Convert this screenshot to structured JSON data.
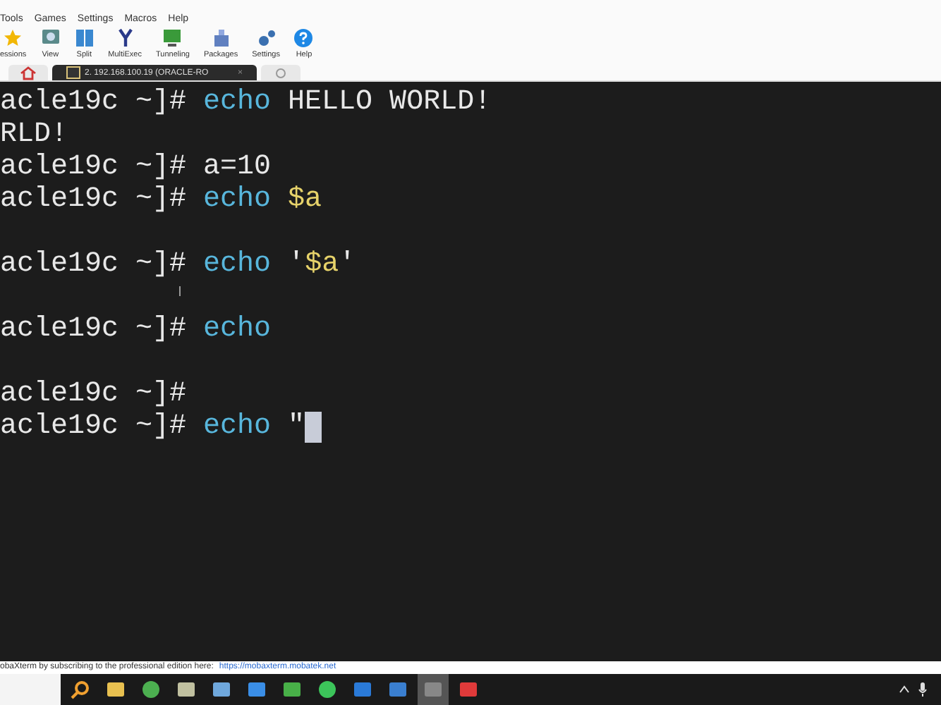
{
  "menu_bar": [
    "Tools",
    "Games",
    "Settings",
    "Macros",
    "Help"
  ],
  "toolbar": [
    {
      "label": "essions",
      "kind": "star"
    },
    {
      "label": "View",
      "kind": "view"
    },
    {
      "label": "Split",
      "kind": "split"
    },
    {
      "label": "MultiExec",
      "kind": "fork"
    },
    {
      "label": "Tunneling",
      "kind": "tunnel"
    },
    {
      "label": "Packages",
      "kind": "package"
    },
    {
      "label": "Settings",
      "kind": "gears"
    },
    {
      "label": "Help",
      "kind": "help"
    }
  ],
  "tabs": [
    {
      "kind": "home",
      "selected": false
    },
    {
      "kind": "session",
      "label": "2. 192.168.100.19 (ORACLE-RO",
      "close": "×",
      "selected": true
    },
    {
      "kind": "new",
      "selected": false
    }
  ],
  "terminal_lines": [
    {
      "kind": "text",
      "segments": [
        {
          "text": "acle19c ~]# ",
          "kind": "prompt"
        },
        {
          "text": "echo",
          "kind": "command"
        },
        {
          "text": " HELLO WORLD!",
          "kind": "text"
        }
      ]
    },
    {
      "kind": "text",
      "segments": [
        {
          "text": "RLD!",
          "kind": "text"
        }
      ]
    },
    {
      "kind": "text",
      "segments": [
        {
          "text": "acle19c ~]# ",
          "kind": "prompt"
        },
        {
          "text": "a=10",
          "kind": "text"
        }
      ]
    },
    {
      "kind": "text",
      "segments": [
        {
          "text": "acle19c ~]# ",
          "kind": "prompt"
        },
        {
          "text": "echo ",
          "kind": "command"
        },
        {
          "text": "$a",
          "kind": "variable"
        }
      ]
    },
    {
      "kind": "blank"
    },
    {
      "kind": "text",
      "segments": [
        {
          "text": "acle19c ~]# ",
          "kind": "prompt"
        },
        {
          "text": "echo",
          "kind": "command"
        },
        {
          "text": " '",
          "kind": "text"
        },
        {
          "text": "$a",
          "kind": "variable"
        },
        {
          "text": "'",
          "kind": "text"
        }
      ]
    },
    {
      "kind": "blank"
    },
    {
      "kind": "text",
      "segments": [
        {
          "text": "acle19c ~]# ",
          "kind": "prompt"
        },
        {
          "text": "echo",
          "kind": "command"
        }
      ]
    },
    {
      "kind": "blank"
    },
    {
      "kind": "text",
      "segments": [
        {
          "text": "acle19c ~]#",
          "kind": "prompt"
        }
      ]
    },
    {
      "kind": "text",
      "segments": [
        {
          "text": "acle19c ~]# ",
          "kind": "prompt"
        },
        {
          "text": "echo",
          "kind": "command"
        },
        {
          "text": " \"",
          "kind": "text"
        },
        {
          "kind": "cursor"
        }
      ]
    }
  ],
  "status_bar": {
    "text": "obaXterm by subscribing to the professional edition here:",
    "link": "https://mobaxterm.mobatek.net"
  },
  "taskbar": [
    {
      "kind": "search",
      "active": false
    },
    {
      "kind": "folder",
      "active": false
    },
    {
      "kind": "chrome",
      "active": false
    },
    {
      "kind": "bird",
      "active": false
    },
    {
      "kind": "cube",
      "active": false
    },
    {
      "kind": "window",
      "active": false
    },
    {
      "kind": "sheet",
      "active": false
    },
    {
      "kind": "chat",
      "active": false
    },
    {
      "kind": "p",
      "active": false
    },
    {
      "kind": "plane",
      "active": false
    },
    {
      "kind": "terminal",
      "active": true
    },
    {
      "kind": "red",
      "active": false
    }
  ]
}
